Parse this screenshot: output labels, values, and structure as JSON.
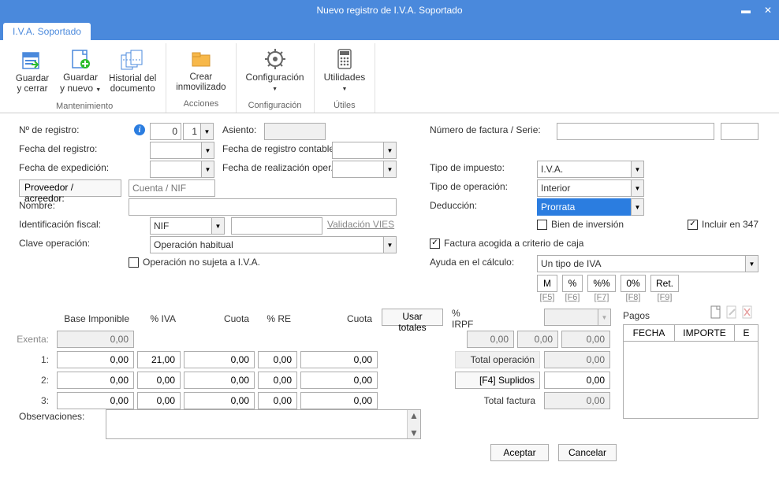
{
  "window": {
    "title": "Nuevo registro de I.V.A. Soportado",
    "tab": "I.V.A. Soportado"
  },
  "ribbon": {
    "guardar_cerrar": "Guardar\ny cerrar",
    "guardar_nuevo": "Guardar\ny nuevo",
    "historial": "Historial del\ndocumento",
    "crear_inmov": "Crear\ninmovilizado",
    "config": "Configuración",
    "utilidades": "Utilidades",
    "grp_mant": "Mantenimiento",
    "grp_acc": "Acciones",
    "grp_conf": "Configuración",
    "grp_util": "Útiles"
  },
  "labels": {
    "n_registro": "Nº de registro:",
    "fecha_registro": "Fecha del registro:",
    "fecha_exped": "Fecha de expedición:",
    "proveedor": "Proveedor / acreedor:",
    "nombre": "Nombre:",
    "ident_fiscal": "Identificación fiscal:",
    "clave_op": "Clave operación:",
    "asiento": "Asiento:",
    "fecha_reg_cont": "Fecha de registro contable:",
    "fecha_real_oper": "Fecha de realización oper.:",
    "valid_vies": "Validación VIES",
    "op_no_sujeta": "Operación no sujeta a I.V.A.",
    "num_factura": "Número de factura / Serie:",
    "tipo_impuesto": "Tipo de impuesto:",
    "tipo_operacion": "Tipo de operación:",
    "deduccion": "Deducción:",
    "bien_inversion": "Bien de inversión",
    "incluir_347": "Incluir en 347",
    "factura_criterio": "Factura acogida a criterio de caja",
    "ayuda_calc": "Ayuda en el cálculo:",
    "observaciones": "Observaciones:",
    "pagos": "Pagos"
  },
  "values": {
    "n_reg1": "0",
    "n_reg2": "1",
    "cuenta_nif": "Cuenta / NIF",
    "ident_fiscal_sel": "NIF",
    "clave_op_sel": "Operación habitual",
    "tipo_impuesto_sel": "I.V.A.",
    "tipo_operacion_sel": "Interior",
    "deduccion_sel": "Prorrata",
    "ayuda_calc_sel": "Un tipo de IVA"
  },
  "helpbtns": {
    "m": "M",
    "pct": "%",
    "pctpct": "%%",
    "zeropct": "0%",
    "ret": "Ret.",
    "f5": "[F5]",
    "f6": "[F6]",
    "f7": "[F7]",
    "f8": "[F8]",
    "f9": "[F9]"
  },
  "grid": {
    "hd_base": "Base Imponible",
    "hd_pctiva": "% IVA",
    "hd_cuota": "Cuota",
    "hd_pctre": "% RE",
    "hd_cuota2": "Cuota",
    "hd_usar": "Usar totales",
    "hd_pctirpf": "% IRPF",
    "exenta": "Exenta:",
    "r1": "1:",
    "r2": "2:",
    "r3": "3:",
    "tot_op": "Total operación",
    "suplidos": "[F4] Suplidos",
    "tot_fact": "Total factura",
    "v_exenta": "0,00",
    "v1_base": "0,00",
    "v1_iva": "21,00",
    "v1_cuota": "0,00",
    "v1_re": "0,00",
    "v1_cuota2": "0,00",
    "v2_base": "0,00",
    "v2_iva": "0,00",
    "v2_cuota": "0,00",
    "v2_re": "0,00",
    "v2_cuota2": "0,00",
    "v3_base": "0,00",
    "v3_iva": "0,00",
    "v3_cuota": "0,00",
    "v3_re": "0,00",
    "v3_cuota2": "0,00",
    "v_irpf1": "0,00",
    "v_irpf2": "0,00",
    "v_irpf3": "0,00",
    "v_totop": "0,00",
    "v_supl": "0,00",
    "v_totfact": "0,00"
  },
  "pagos": {
    "fecha": "FECHA",
    "importe": "IMPORTE",
    "e": "E"
  },
  "buttons": {
    "aceptar": "Aceptar",
    "cancelar": "Cancelar"
  }
}
